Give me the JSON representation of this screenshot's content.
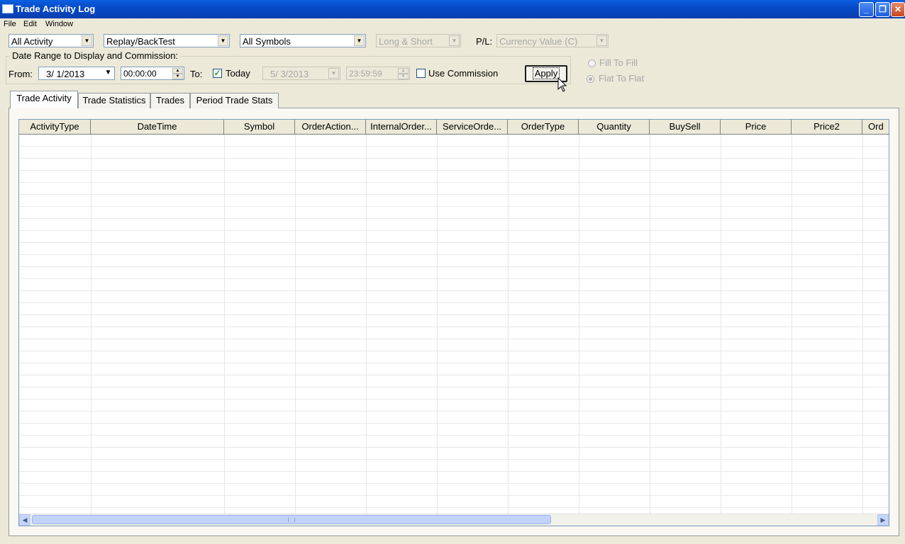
{
  "window": {
    "title": "Trade Activity Log"
  },
  "menu": [
    "File",
    "Edit",
    "Window"
  ],
  "filters": {
    "activity": "All Activity",
    "mode": "Replay/BackTest",
    "symbols": "All Symbols",
    "direction": "Long & Short",
    "pl_label": "P/L:",
    "pl_value": "Currency Value (C)"
  },
  "date_range": {
    "legend": "Date Range to Display and Commission:",
    "from_label": "From:",
    "from_date": "3/ 1/2013",
    "from_time": "00:00:00",
    "to_label": "To:",
    "today_label": "Today",
    "today_checked": true,
    "to_date": "5/ 3/2013",
    "to_time": "23:59:59",
    "use_commission_label": "Use Commission",
    "use_commission_checked": false,
    "apply_label": "Apply"
  },
  "options": {
    "fill_to_fill": "Fill To Fill",
    "flat_to_flat": "Flat To Flat",
    "selected": "flat_to_flat"
  },
  "tabs": [
    {
      "label": "Trade Activity",
      "active": true
    },
    {
      "label": "Trade Statistics",
      "active": false
    },
    {
      "label": "Trades",
      "active": false
    },
    {
      "label": "Period Trade Stats",
      "active": false
    }
  ],
  "grid": {
    "columns": [
      "ActivityType",
      "DateTime",
      "Symbol",
      "OrderAction...",
      "InternalOrder...",
      "ServiceOrde...",
      "OrderType",
      "Quantity",
      "BuySell",
      "Price",
      "Price2",
      "Ord"
    ]
  },
  "colors": {
    "titlebar": "#0649c6",
    "window_bg": "#ece9d8"
  }
}
